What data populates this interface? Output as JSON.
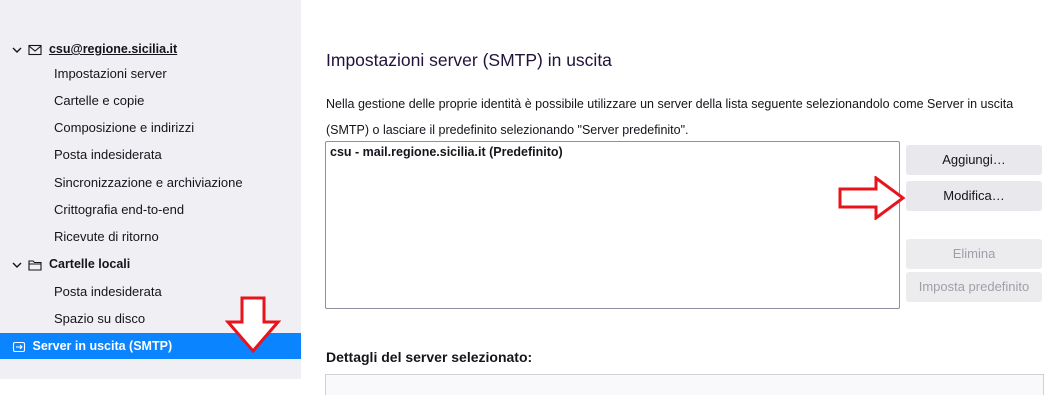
{
  "sidebar": {
    "account": {
      "label": "csu@regione.sicilia.it"
    },
    "account_items": [
      {
        "label": "Impostazioni server"
      },
      {
        "label": "Cartelle e copie"
      },
      {
        "label": "Composizione e indirizzi"
      },
      {
        "label": "Posta indesiderata"
      },
      {
        "label": "Sincronizzazione e archiviazione"
      },
      {
        "label": "Crittografia end-to-end"
      },
      {
        "label": "Ricevute di ritorno"
      }
    ],
    "local_folders": {
      "label": "Cartelle locali"
    },
    "local_items": [
      {
        "label": "Posta indesiderata"
      },
      {
        "label": "Spazio su disco"
      }
    ],
    "outgoing_server": {
      "label": "Server in uscita (SMTP)"
    }
  },
  "main": {
    "title": "Impostazioni server (SMTP) in uscita",
    "description": "Nella gestione delle proprie identità è possibile utilizzare un server della lista seguente selezionandolo come Server in uscita (SMTP) o lasciare il predefinito selezionando \"Server predefinito\".",
    "servers": [
      {
        "label": "csu - mail.regione.sicilia.it (Predefinito)"
      }
    ],
    "buttons": {
      "add": "Aggiungi…",
      "edit": "Modifica…",
      "remove": "Elimina",
      "set_default": "Imposta predefinito"
    },
    "details_title": "Dettagli del server selezionato:"
  },
  "colors": {
    "accent": "#0a84ff",
    "arrow": "#e8141c",
    "sidebar_bg": "#f0f0f4"
  }
}
